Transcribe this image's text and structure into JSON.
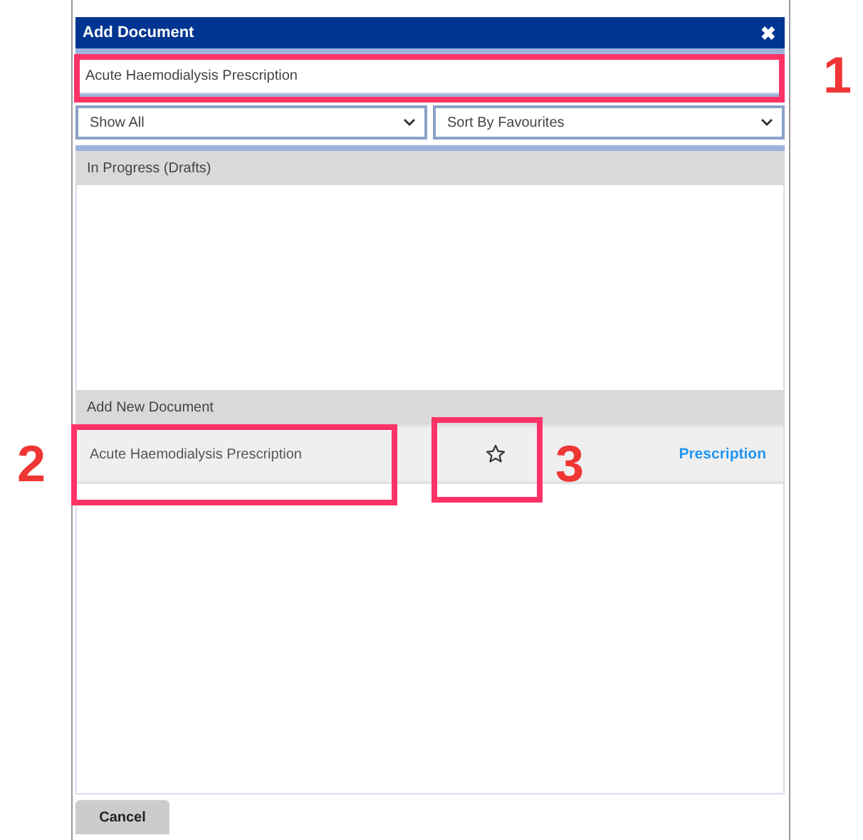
{
  "dialog": {
    "title": "Add Document",
    "close_icon": "✖"
  },
  "search": {
    "value": "Acute Haemodialysis Prescription"
  },
  "filters": [
    {
      "value": "Show All"
    },
    {
      "value": "Sort By Favourites"
    }
  ],
  "sections": [
    {
      "title": "In Progress (Drafts)"
    },
    {
      "title": "Add New Document",
      "documents": [
        {
          "name": "Acute Haemodialysis Prescription",
          "favourite": false,
          "category": "Prescription"
        }
      ]
    }
  ],
  "buttons": [
    "Cancel"
  ],
  "annotations": [
    {
      "label": "1"
    },
    {
      "label": "2"
    },
    {
      "label": "3"
    }
  ]
}
